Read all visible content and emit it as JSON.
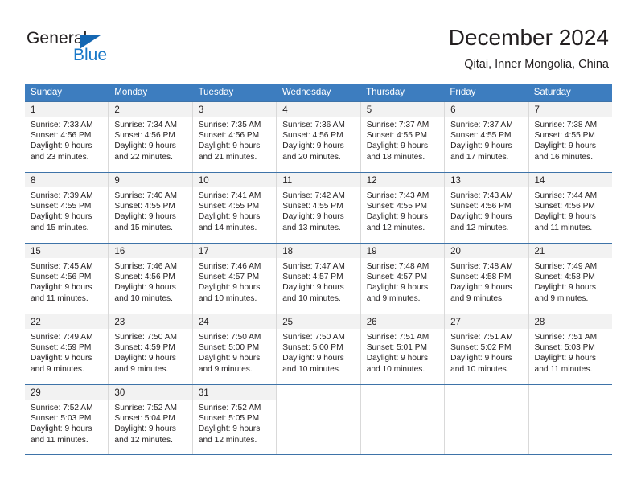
{
  "brand": {
    "name_top": "General",
    "name_bottom": "Blue",
    "accent_color": "#1878c8",
    "triangle_color": "#1567b2"
  },
  "header": {
    "title": "December 2024",
    "subtitle": "Qitai, Inner Mongolia, China"
  },
  "theme": {
    "header_row_bg": "#3d7dbf",
    "header_row_text": "#ffffff",
    "week_rule": "#3e73a8",
    "daynum_band": "#f2f2f2",
    "cell_divider": "#d9d9d9",
    "text": "#231f20"
  },
  "weekdays": [
    "Sunday",
    "Monday",
    "Tuesday",
    "Wednesday",
    "Thursday",
    "Friday",
    "Saturday"
  ],
  "weeks": [
    [
      {
        "day": "1",
        "sunrise": "Sunrise: 7:33 AM",
        "sunset": "Sunset: 4:56 PM",
        "daylight1": "Daylight: 9 hours",
        "daylight2": "and 23 minutes."
      },
      {
        "day": "2",
        "sunrise": "Sunrise: 7:34 AM",
        "sunset": "Sunset: 4:56 PM",
        "daylight1": "Daylight: 9 hours",
        "daylight2": "and 22 minutes."
      },
      {
        "day": "3",
        "sunrise": "Sunrise: 7:35 AM",
        "sunset": "Sunset: 4:56 PM",
        "daylight1": "Daylight: 9 hours",
        "daylight2": "and 21 minutes."
      },
      {
        "day": "4",
        "sunrise": "Sunrise: 7:36 AM",
        "sunset": "Sunset: 4:56 PM",
        "daylight1": "Daylight: 9 hours",
        "daylight2": "and 20 minutes."
      },
      {
        "day": "5",
        "sunrise": "Sunrise: 7:37 AM",
        "sunset": "Sunset: 4:55 PM",
        "daylight1": "Daylight: 9 hours",
        "daylight2": "and 18 minutes."
      },
      {
        "day": "6",
        "sunrise": "Sunrise: 7:37 AM",
        "sunset": "Sunset: 4:55 PM",
        "daylight1": "Daylight: 9 hours",
        "daylight2": "and 17 minutes."
      },
      {
        "day": "7",
        "sunrise": "Sunrise: 7:38 AM",
        "sunset": "Sunset: 4:55 PM",
        "daylight1": "Daylight: 9 hours",
        "daylight2": "and 16 minutes."
      }
    ],
    [
      {
        "day": "8",
        "sunrise": "Sunrise: 7:39 AM",
        "sunset": "Sunset: 4:55 PM",
        "daylight1": "Daylight: 9 hours",
        "daylight2": "and 15 minutes."
      },
      {
        "day": "9",
        "sunrise": "Sunrise: 7:40 AM",
        "sunset": "Sunset: 4:55 PM",
        "daylight1": "Daylight: 9 hours",
        "daylight2": "and 15 minutes."
      },
      {
        "day": "10",
        "sunrise": "Sunrise: 7:41 AM",
        "sunset": "Sunset: 4:55 PM",
        "daylight1": "Daylight: 9 hours",
        "daylight2": "and 14 minutes."
      },
      {
        "day": "11",
        "sunrise": "Sunrise: 7:42 AM",
        "sunset": "Sunset: 4:55 PM",
        "daylight1": "Daylight: 9 hours",
        "daylight2": "and 13 minutes."
      },
      {
        "day": "12",
        "sunrise": "Sunrise: 7:43 AM",
        "sunset": "Sunset: 4:55 PM",
        "daylight1": "Daylight: 9 hours",
        "daylight2": "and 12 minutes."
      },
      {
        "day": "13",
        "sunrise": "Sunrise: 7:43 AM",
        "sunset": "Sunset: 4:56 PM",
        "daylight1": "Daylight: 9 hours",
        "daylight2": "and 12 minutes."
      },
      {
        "day": "14",
        "sunrise": "Sunrise: 7:44 AM",
        "sunset": "Sunset: 4:56 PM",
        "daylight1": "Daylight: 9 hours",
        "daylight2": "and 11 minutes."
      }
    ],
    [
      {
        "day": "15",
        "sunrise": "Sunrise: 7:45 AM",
        "sunset": "Sunset: 4:56 PM",
        "daylight1": "Daylight: 9 hours",
        "daylight2": "and 11 minutes."
      },
      {
        "day": "16",
        "sunrise": "Sunrise: 7:46 AM",
        "sunset": "Sunset: 4:56 PM",
        "daylight1": "Daylight: 9 hours",
        "daylight2": "and 10 minutes."
      },
      {
        "day": "17",
        "sunrise": "Sunrise: 7:46 AM",
        "sunset": "Sunset: 4:57 PM",
        "daylight1": "Daylight: 9 hours",
        "daylight2": "and 10 minutes."
      },
      {
        "day": "18",
        "sunrise": "Sunrise: 7:47 AM",
        "sunset": "Sunset: 4:57 PM",
        "daylight1": "Daylight: 9 hours",
        "daylight2": "and 10 minutes."
      },
      {
        "day": "19",
        "sunrise": "Sunrise: 7:48 AM",
        "sunset": "Sunset: 4:57 PM",
        "daylight1": "Daylight: 9 hours",
        "daylight2": "and 9 minutes."
      },
      {
        "day": "20",
        "sunrise": "Sunrise: 7:48 AM",
        "sunset": "Sunset: 4:58 PM",
        "daylight1": "Daylight: 9 hours",
        "daylight2": "and 9 minutes."
      },
      {
        "day": "21",
        "sunrise": "Sunrise: 7:49 AM",
        "sunset": "Sunset: 4:58 PM",
        "daylight1": "Daylight: 9 hours",
        "daylight2": "and 9 minutes."
      }
    ],
    [
      {
        "day": "22",
        "sunrise": "Sunrise: 7:49 AM",
        "sunset": "Sunset: 4:59 PM",
        "daylight1": "Daylight: 9 hours",
        "daylight2": "and 9 minutes."
      },
      {
        "day": "23",
        "sunrise": "Sunrise: 7:50 AM",
        "sunset": "Sunset: 4:59 PM",
        "daylight1": "Daylight: 9 hours",
        "daylight2": "and 9 minutes."
      },
      {
        "day": "24",
        "sunrise": "Sunrise: 7:50 AM",
        "sunset": "Sunset: 5:00 PM",
        "daylight1": "Daylight: 9 hours",
        "daylight2": "and 9 minutes."
      },
      {
        "day": "25",
        "sunrise": "Sunrise: 7:50 AM",
        "sunset": "Sunset: 5:00 PM",
        "daylight1": "Daylight: 9 hours",
        "daylight2": "and 10 minutes."
      },
      {
        "day": "26",
        "sunrise": "Sunrise: 7:51 AM",
        "sunset": "Sunset: 5:01 PM",
        "daylight1": "Daylight: 9 hours",
        "daylight2": "and 10 minutes."
      },
      {
        "day": "27",
        "sunrise": "Sunrise: 7:51 AM",
        "sunset": "Sunset: 5:02 PM",
        "daylight1": "Daylight: 9 hours",
        "daylight2": "and 10 minutes."
      },
      {
        "day": "28",
        "sunrise": "Sunrise: 7:51 AM",
        "sunset": "Sunset: 5:03 PM",
        "daylight1": "Daylight: 9 hours",
        "daylight2": "and 11 minutes."
      }
    ],
    [
      {
        "day": "29",
        "sunrise": "Sunrise: 7:52 AM",
        "sunset": "Sunset: 5:03 PM",
        "daylight1": "Daylight: 9 hours",
        "daylight2": "and 11 minutes."
      },
      {
        "day": "30",
        "sunrise": "Sunrise: 7:52 AM",
        "sunset": "Sunset: 5:04 PM",
        "daylight1": "Daylight: 9 hours",
        "daylight2": "and 12 minutes."
      },
      {
        "day": "31",
        "sunrise": "Sunrise: 7:52 AM",
        "sunset": "Sunset: 5:05 PM",
        "daylight1": "Daylight: 9 hours",
        "daylight2": "and 12 minutes."
      },
      {
        "day": "",
        "sunrise": "",
        "sunset": "",
        "daylight1": "",
        "daylight2": ""
      },
      {
        "day": "",
        "sunrise": "",
        "sunset": "",
        "daylight1": "",
        "daylight2": ""
      },
      {
        "day": "",
        "sunrise": "",
        "sunset": "",
        "daylight1": "",
        "daylight2": ""
      },
      {
        "day": "",
        "sunrise": "",
        "sunset": "",
        "daylight1": "",
        "daylight2": ""
      }
    ]
  ]
}
